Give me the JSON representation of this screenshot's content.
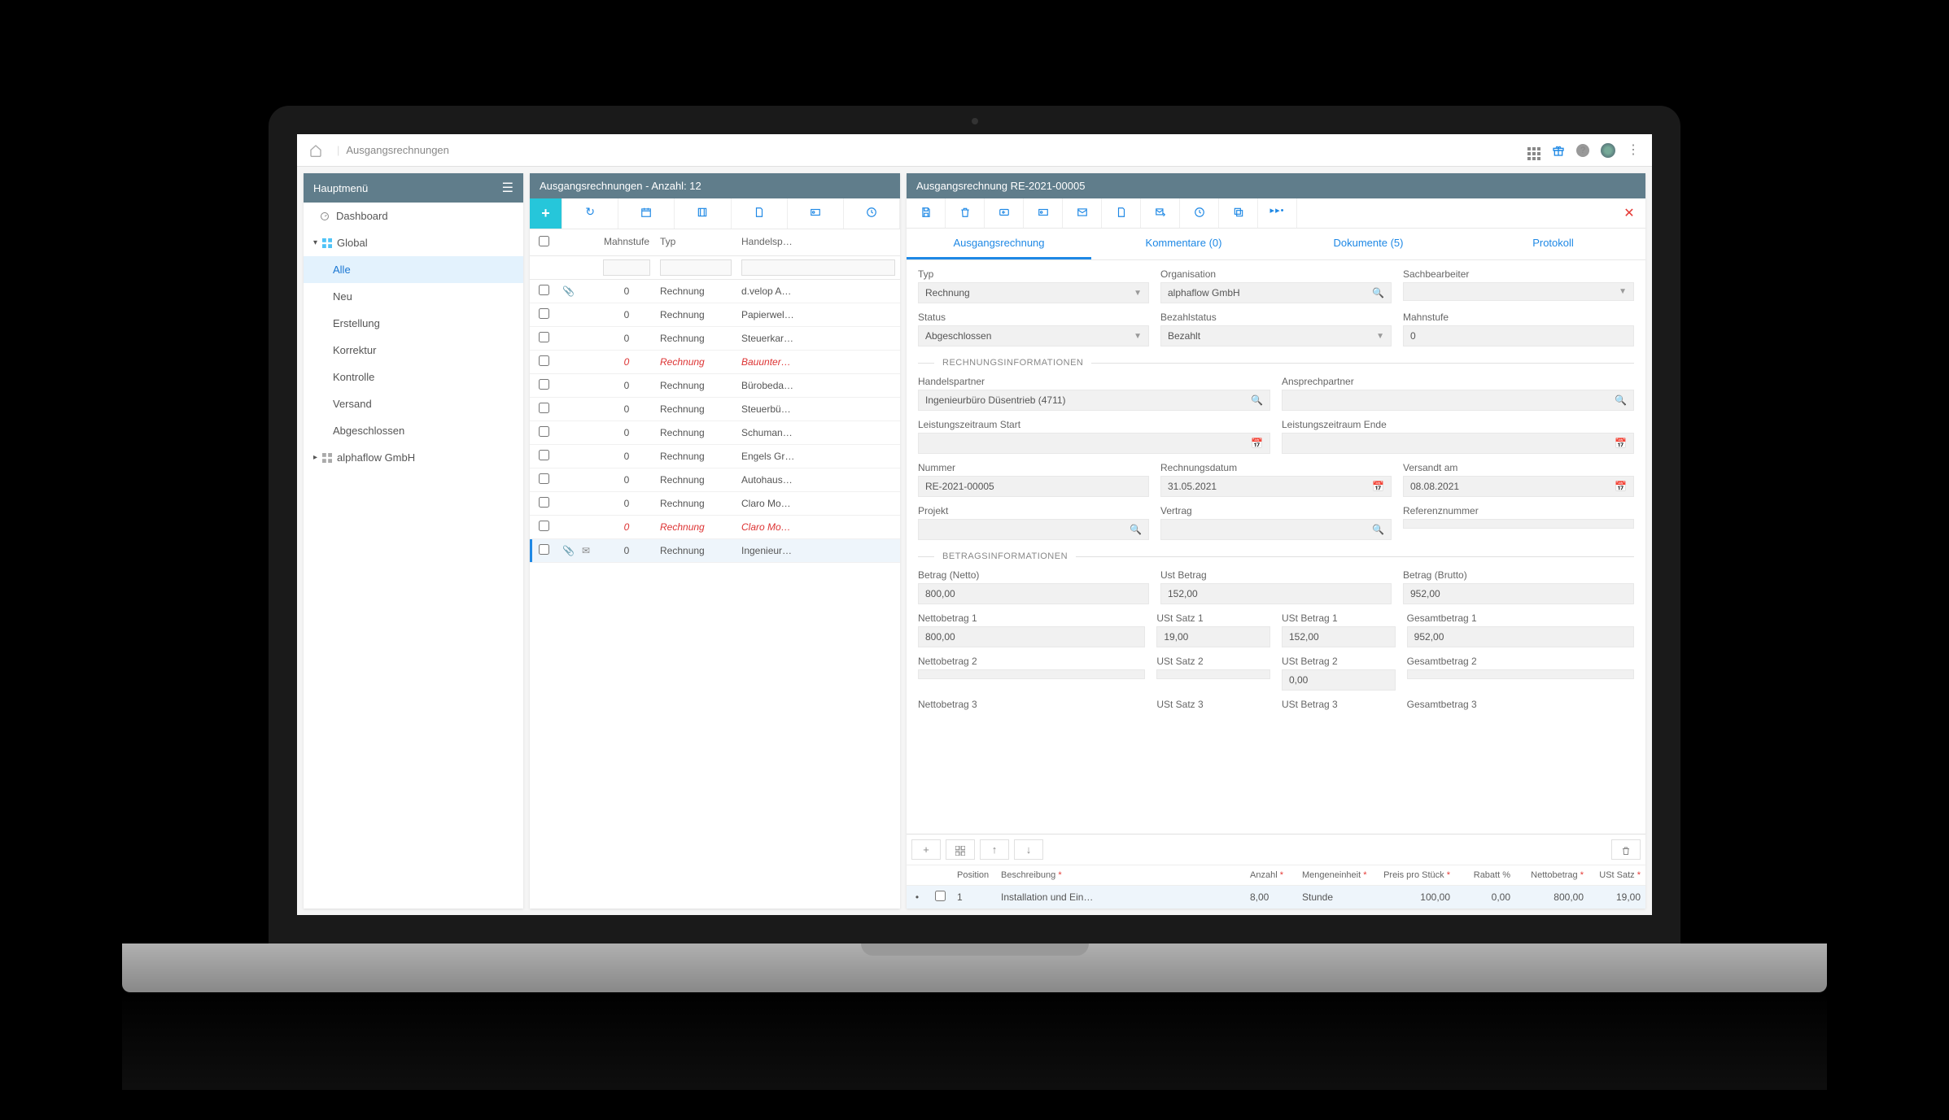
{
  "breadcrumb": "Ausgangsrechnungen",
  "sidebar": {
    "title": "Hauptmenü",
    "dashboard": "Dashboard",
    "global": "Global",
    "items": [
      "Alle",
      "Neu",
      "Erstellung",
      "Korrektur",
      "Kontrolle",
      "Versand",
      "Abgeschlossen"
    ],
    "selectedIndex": 0,
    "org": "alphaflow GmbH"
  },
  "list": {
    "title": "Ausgangsrechnungen - Anzahl: 12",
    "headers": {
      "mahnstufe": "Mahnstufe",
      "typ": "Typ",
      "handelspartner": "Handelsp…"
    },
    "rows": [
      {
        "att": true,
        "mahn": "0",
        "typ": "Rechnung",
        "han": "d.velop A…",
        "red": false
      },
      {
        "att": false,
        "mahn": "0",
        "typ": "Rechnung",
        "han": "Papierwel…",
        "red": false
      },
      {
        "att": false,
        "mahn": "0",
        "typ": "Rechnung",
        "han": "Steuerkar…",
        "red": false
      },
      {
        "att": false,
        "mahn": "0",
        "typ": "Rechnung",
        "han": "Bauunter…",
        "red": true
      },
      {
        "att": false,
        "mahn": "0",
        "typ": "Rechnung",
        "han": "Bürobeda…",
        "red": false
      },
      {
        "att": false,
        "mahn": "0",
        "typ": "Rechnung",
        "han": "Steuerbü…",
        "red": false
      },
      {
        "att": false,
        "mahn": "0",
        "typ": "Rechnung",
        "han": "Schuman…",
        "red": false
      },
      {
        "att": false,
        "mahn": "0",
        "typ": "Rechnung",
        "han": "Engels Gr…",
        "red": false
      },
      {
        "att": false,
        "mahn": "0",
        "typ": "Rechnung",
        "han": "Autohaus…",
        "red": false
      },
      {
        "att": false,
        "mahn": "0",
        "typ": "Rechnung",
        "han": "Claro Mo…",
        "red": false
      },
      {
        "att": false,
        "mahn": "0",
        "typ": "Rechnung",
        "han": "Claro Mo…",
        "red": true
      },
      {
        "att": true,
        "mail": true,
        "mahn": "0",
        "typ": "Rechnung",
        "han": "Ingenieur…",
        "red": false,
        "selected": true
      }
    ]
  },
  "detail": {
    "title": "Ausgangsrechnung RE-2021-00005",
    "tabs": {
      "main": "Ausgangsrechnung",
      "comments": "Kommentare (0)",
      "docs": "Dokumente (5)",
      "protocol": "Protokoll"
    },
    "fields": {
      "typ_l": "Typ",
      "typ_v": "Rechnung",
      "org_l": "Organisation",
      "org_v": "alphaflow GmbH",
      "sach_l": "Sachbearbeiter",
      "sach_v": "",
      "status_l": "Status",
      "status_v": "Abgeschlossen",
      "bezahl_l": "Bezahlstatus",
      "bezahl_v": "Bezahlt",
      "mahn_l": "Mahnstufe",
      "mahn_v": "0",
      "sec1": "RECHNUNGSINFORMATIONEN",
      "partner_l": "Handelspartner",
      "partner_v": "Ingenieurbüro Düsentrieb (4711)",
      "ansprech_l": "Ansprechpartner",
      "ansprech_v": "",
      "lzstart_l": "Leistungszeitraum Start",
      "lzstart_v": "",
      "lzende_l": "Leistungszeitraum Ende",
      "lzende_v": "",
      "nummer_l": "Nummer",
      "nummer_v": "RE-2021-00005",
      "rdatum_l": "Rechnungsdatum",
      "rdatum_v": "31.05.2021",
      "versandt_l": "Versandt am",
      "versandt_v": "08.08.2021",
      "projekt_l": "Projekt",
      "projekt_v": "",
      "vertrag_l": "Vertrag",
      "vertrag_v": "",
      "ref_l": "Referenznummer",
      "ref_v": "",
      "sec2": "BETRAGSINFORMATIONEN",
      "bnetto_l": "Betrag (Netto)",
      "bnetto_v": "800,00",
      "ustbetrag_l": "Ust Betrag",
      "ustbetrag_v": "152,00",
      "bbrutto_l": "Betrag (Brutto)",
      "bbrutto_v": "952,00",
      "net1_l": "Nettobetrag 1",
      "net1_v": "800,00",
      "ustsatz1_l": "USt Satz 1",
      "ustsatz1_v": "19,00",
      "ustb1_l": "USt Betrag 1",
      "ustb1_v": "152,00",
      "ges1_l": "Gesamtbetrag 1",
      "ges1_v": "952,00",
      "net2_l": "Nettobetrag 2",
      "net2_v": "",
      "ustsatz2_l": "USt Satz 2",
      "ustsatz2_v": "",
      "ustb2_l": "USt Betrag 2",
      "ustb2_v": "0,00",
      "ges2_l": "Gesamtbetrag 2",
      "ges2_v": "",
      "net3_l": "Nettobetrag 3",
      "ustsatz3_l": "USt Satz 3",
      "ustb3_l": "USt Betrag 3",
      "ges3_l": "Gesamtbetrag 3"
    },
    "positions": {
      "headers": {
        "pos": "Position",
        "desc": "Beschreibung",
        "anz": "Anzahl",
        "me": "Mengeneinheit",
        "pps": "Preis pro Stück",
        "rab": "Rabatt %",
        "net": "Nettobetrag",
        "ust": "USt Satz"
      },
      "rows": [
        {
          "pos": "1",
          "desc": "Installation und Ein…",
          "anz": "8,00",
          "me": "Stunde",
          "pps": "100,00",
          "rab": "0,00",
          "net": "800,00",
          "ust": "19,00"
        }
      ]
    }
  }
}
